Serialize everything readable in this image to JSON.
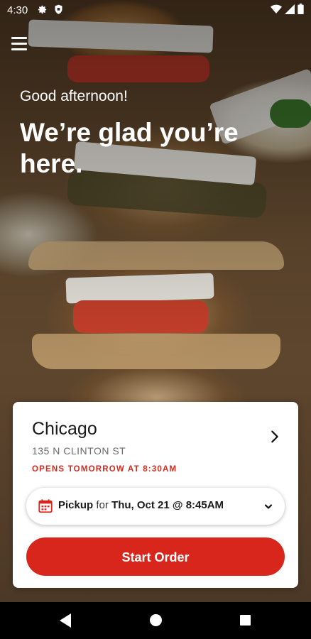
{
  "status_bar": {
    "time": "4:30",
    "icons": [
      "gear-icon",
      "shield-icon",
      "wifi-icon",
      "signal-icon",
      "battery-icon"
    ]
  },
  "header": {
    "greeting": "Good afternoon!",
    "headline": "We’re glad you’re here."
  },
  "location_card": {
    "city": "Chicago",
    "address": "135 N CLINTON ST",
    "hours_status": "OPENS TOMORROW AT 8:30AM",
    "pickup": {
      "mode": "Pickup",
      "connector": "for",
      "datetime": "Thu, Oct 21 @ 8:45AM"
    },
    "start_order_label": "Start Order"
  },
  "colors": {
    "accent": "#d9261c",
    "hours_text": "#d22a1f"
  }
}
